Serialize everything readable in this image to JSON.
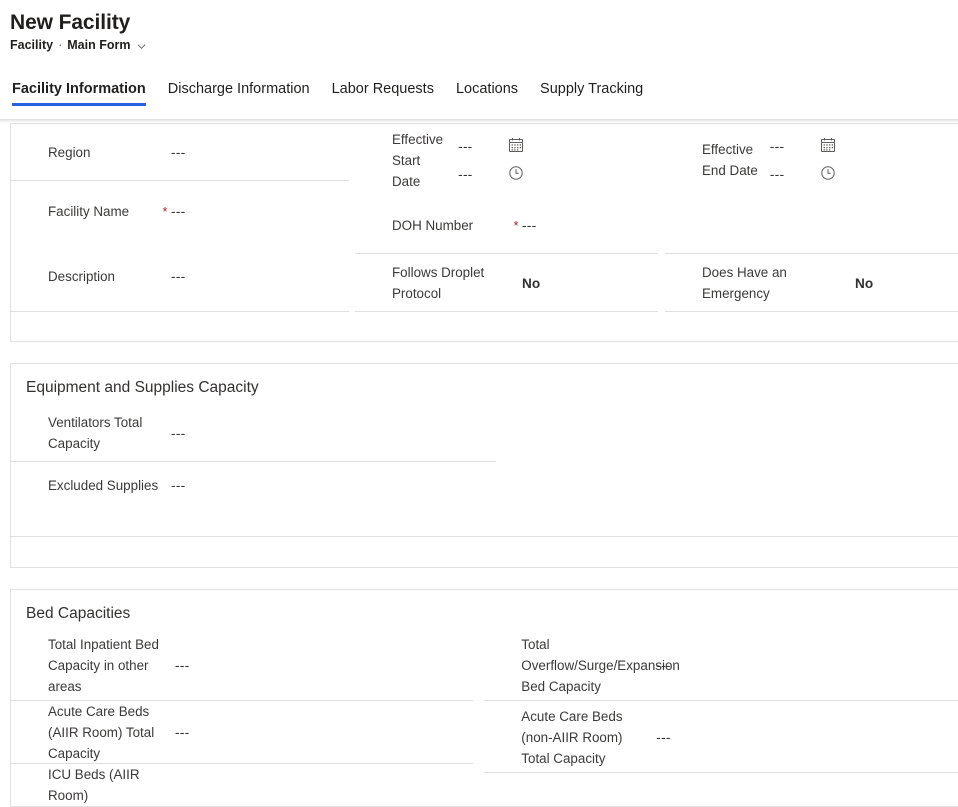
{
  "header": {
    "record_title": "New Facility",
    "entity_name": "Facility",
    "separator": "·",
    "form_name": "Main Form",
    "chevron_icon": "chevron-down-icon"
  },
  "tabs": [
    {
      "label": "Facility Information",
      "selected": true
    },
    {
      "label": "Discharge Information",
      "selected": false
    },
    {
      "label": "Labor Requests",
      "selected": false
    },
    {
      "label": "Locations",
      "selected": false
    },
    {
      "label": "Supply Tracking",
      "selected": false
    }
  ],
  "placeholder_value": "---",
  "required_marker": "*",
  "icons": {
    "calendar": "calendar-icon",
    "clock": "clock-icon"
  },
  "colors": {
    "accent": "#2b60e0",
    "required": "#a4262c",
    "divider": "#e1dfdd",
    "card_border": "#e3e1df",
    "label_text": "#3b3a39",
    "value_text": "#323130"
  },
  "sections": [
    {
      "id": "facility-information",
      "title": "",
      "columns": [
        {
          "fields": [
            {
              "label": "Region",
              "value": "---",
              "required": false
            },
            {
              "label": "Facility Name",
              "value": "---",
              "required": true
            },
            {
              "label": "Description",
              "value": "---",
              "required": false
            }
          ]
        },
        {
          "fields": [
            {
              "label": "Effective Start Date",
              "required": false,
              "type": "datetime",
              "date_value": "---",
              "time_value": "---",
              "date_icon": "calendar-icon",
              "time_icon": "clock-icon"
            },
            {
              "label": "DOH Number",
              "value": "---",
              "required": true
            },
            {
              "label": "Follows Droplet Protocol",
              "value": "No",
              "required": false,
              "type": "boolean"
            }
          ]
        },
        {
          "fields": [
            {
              "label": "Effective End Date",
              "required": false,
              "type": "datetime",
              "date_value": "---",
              "time_value": "---",
              "date_icon": "calendar-icon",
              "time_icon": "clock-icon"
            },
            {
              "label": "Does Have an Emergency",
              "value": "No",
              "required": false,
              "type": "boolean"
            }
          ]
        }
      ]
    },
    {
      "id": "equipment-and-supplies-capacity",
      "title": "Equipment and Supplies Capacity",
      "columns": [
        {
          "fields": [
            {
              "label": "Ventilators Total Capacity",
              "value": "---",
              "required": false
            },
            {
              "label": "Excluded Supplies",
              "value": "---",
              "required": false
            }
          ]
        }
      ]
    },
    {
      "id": "bed-capacities",
      "title": "Bed Capacities",
      "columns": [
        {
          "fields": [
            {
              "label": "Total Inpatient Bed Capacity in other areas",
              "value": "---",
              "required": false
            },
            {
              "label": "Acute Care Beds (AIIR Room) Total Capacity",
              "value": "---",
              "required": false
            },
            {
              "label": "ICU Beds (AIIR Room)",
              "value": "",
              "required": false
            }
          ]
        },
        {
          "fields": [
            {
              "label": "Total Overflow/Surge/Expansion Bed Capacity",
              "value": "---",
              "required": false
            },
            {
              "label": "Acute Care Beds (non-AIIR Room) Total Capacity",
              "value": "---",
              "required": false
            }
          ]
        }
      ]
    }
  ],
  "labels": {
    "region": "Region",
    "facility_name": "Facility Name",
    "description": "Description",
    "effective_start_date": "Effective Start Date",
    "effective_end_date": "Effective End Date",
    "doh_number": "DOH Number",
    "follows_droplet_protocol": "Follows Droplet Protocol",
    "does_have_an_emergency": "Does Have an Emergency",
    "ventilators_total_capacity": "Ventilators Total Capacity",
    "excluded_supplies": "Excluded Supplies",
    "total_inpatient_bed_capacity": "Total Inpatient Bed Capacity in other areas",
    "total_overflow_capacity": "Total Overflow/Surge/Expansion Bed Capacity",
    "acute_care_aiir": "Acute Care Beds (AIIR Room) Total Capacity",
    "acute_care_non_aiir": "Acute Care Beds (non-AIIR Room) Total Capacity",
    "icu_beds_aiir": "ICU Beds (AIIR Room)",
    "section_equipment": "Equipment and Supplies Capacity",
    "section_bed": "Bed Capacities"
  },
  "values": {
    "region": "---",
    "facility_name": "---",
    "description": "---",
    "start_date": "---",
    "start_time": "---",
    "end_date": "---",
    "end_time": "---",
    "doh_number": "---",
    "follows_droplet_protocol": "No",
    "does_have_an_emergency": "No",
    "ventilators_total_capacity": "---",
    "excluded_supplies": "---",
    "total_inpatient_bed_capacity": "---",
    "total_overflow_capacity": "---",
    "acute_care_aiir": "---",
    "acute_care_non_aiir": "---"
  }
}
